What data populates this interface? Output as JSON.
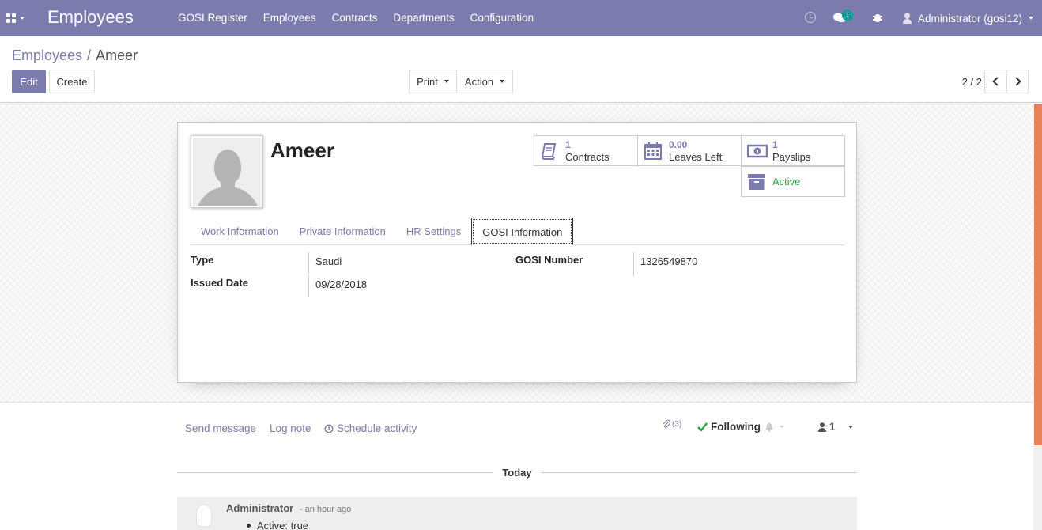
{
  "navbar": {
    "app_title": "Employees",
    "menu": [
      "GOSI Register",
      "Employees",
      "Contracts",
      "Departments",
      "Configuration"
    ],
    "messages_badge": "1",
    "user": "Administrator (gosi12)"
  },
  "breadcrumb": {
    "parent": "Employees",
    "separator": "/",
    "current": "Ameer"
  },
  "buttons": {
    "edit": "Edit",
    "create": "Create",
    "print": "Print",
    "action": "Action"
  },
  "pager": {
    "value": "2 / 2"
  },
  "employee": {
    "name": "Ameer"
  },
  "smart_buttons": {
    "contracts": {
      "value": "1",
      "label": "Contracts"
    },
    "leaves": {
      "value": "0.00",
      "label": "Leaves Left"
    },
    "payslips": {
      "value": "1",
      "label": "Payslips"
    },
    "active": {
      "label": "Active"
    }
  },
  "tabs": [
    "Work Information",
    "Private Information",
    "HR Settings",
    "GOSI Information"
  ],
  "active_tab": "GOSI Information",
  "gosi": {
    "type_label": "Type",
    "type_value": "Saudi",
    "issued_label": "Issued Date",
    "issued_value": "09/28/2018",
    "number_label": "GOSI Number",
    "number_value": "1326549870"
  },
  "chatter": {
    "send_message": "Send message",
    "log_note": "Log note",
    "schedule_activity": "Schedule activity",
    "attachments": "(3)",
    "following": "Following",
    "followers": "1",
    "date_separator": "Today",
    "message": {
      "author": "Administrator",
      "time": "- an hour ago",
      "tracking": "Active: true"
    }
  },
  "colors": {
    "primary": "#7c7bad",
    "success": "#28a745",
    "scroll_accent": "#e8825a"
  }
}
